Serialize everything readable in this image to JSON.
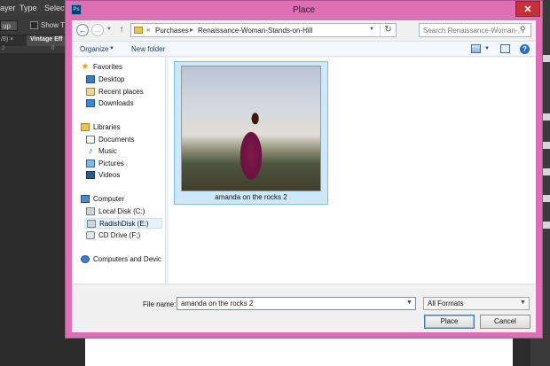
{
  "background": {
    "menu": [
      "ayer",
      "Type",
      "Select"
    ],
    "options": {
      "box_label": "up",
      "checkbox_label": "Show Tra"
    },
    "tab_gray": "/8) ×",
    "tab_label": "Vintage Eff",
    "ruler_marks": [
      "2",
      "0"
    ]
  },
  "dialog": {
    "app_icon": "Ps",
    "title": "Place",
    "close_glyph": "✕",
    "address": {
      "chevrons": "«",
      "segments": [
        "Purchases",
        "Renaissance-Woman-Stands-on-Hill"
      ]
    },
    "search_placeholder": "Search Renaissance-Woman-...",
    "toolbar": {
      "organize": "Organize",
      "new_folder": "New folder"
    },
    "nav": {
      "favorites": "Favorites",
      "desktop": "Desktop",
      "recent_places": "Recent places",
      "downloads": "Downloads",
      "libraries": "Libraries",
      "documents": "Documents",
      "music": "Music",
      "pictures": "Pictures",
      "videos": "Videos",
      "computer": "Computer",
      "local_disk": "Local Disk (C:)",
      "radish_disk": "RadishDisk (E:)",
      "cd_drive": "CD Drive (F:)",
      "network": "Computers and Devic"
    },
    "file": {
      "name": "amanda on the rocks 2"
    },
    "bottom": {
      "file_name_label": "File name:",
      "file_name_value": "amanda on the rocks 2",
      "format": "All Formats",
      "place_label": "Place",
      "cancel_label": "Cancel"
    }
  },
  "colors": {
    "dialog_frame": "#de6fb5",
    "close_button": "#c6303b",
    "selection": "#cce8ff"
  }
}
